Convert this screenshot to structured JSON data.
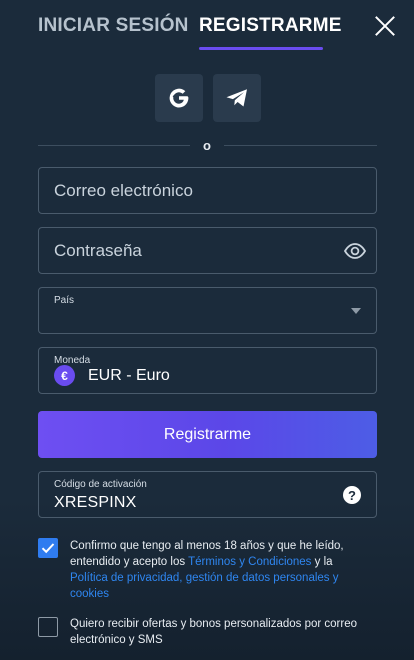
{
  "tabs": {
    "login_label": "INICIAR SESIÓN",
    "register_label": "REGISTRARME"
  },
  "social": {
    "google_icon": "google-icon",
    "telegram_icon": "telegram-icon"
  },
  "divider_text": "o",
  "form": {
    "email_placeholder": "Correo electrónico",
    "password_placeholder": "Contraseña",
    "country_label": "País",
    "country_value": "",
    "currency_label": "Moneda",
    "currency_symbol": "€",
    "currency_value": "EUR - Euro",
    "submit_label": "Registrarme",
    "activation_label": "Código de activación",
    "activation_value": "XRESPINX"
  },
  "consent": {
    "terms_checked": true,
    "terms_prefix": "Confirmo que tengo al menos 18 años y que he leído, entendido y acepto los ",
    "terms_link": "Términos y Condiciones",
    "terms_middle": " y la ",
    "privacy_link": "Política de privacidad, gestión de datos personales y cookies",
    "offers_checked": false,
    "offers_text": "Quiero recibir ofertas y bonos personalizados por correo electrónico y SMS"
  },
  "colors": {
    "background": "#1b2b3b",
    "accent": "#6a4cf0",
    "link": "#2f86f0",
    "checkbox_checked": "#2f7cf0"
  }
}
